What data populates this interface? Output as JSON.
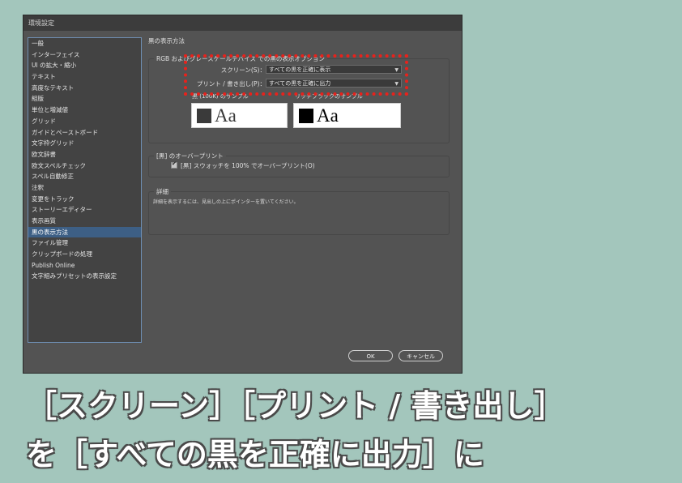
{
  "dialog": {
    "title": "環境設定",
    "ok_label": "OK",
    "cancel_label": "キャンセル"
  },
  "sidebar": {
    "items": [
      {
        "label": "一般",
        "selected": false
      },
      {
        "label": "インターフェイス",
        "selected": false
      },
      {
        "label": "UI の拡大・縮小",
        "selected": false
      },
      {
        "label": "テキスト",
        "selected": false
      },
      {
        "label": "高度なテキスト",
        "selected": false
      },
      {
        "label": "組版",
        "selected": false
      },
      {
        "label": "単位と増減値",
        "selected": false
      },
      {
        "label": "グリッド",
        "selected": false
      },
      {
        "label": "ガイドとペーストボード",
        "selected": false
      },
      {
        "label": "文字枠グリッド",
        "selected": false
      },
      {
        "label": "欧文辞書",
        "selected": false
      },
      {
        "label": "欧文スペルチェック",
        "selected": false
      },
      {
        "label": "スペル自動修正",
        "selected": false
      },
      {
        "label": "注釈",
        "selected": false
      },
      {
        "label": "変更をトラック",
        "selected": false
      },
      {
        "label": "ストーリーエディター",
        "selected": false
      },
      {
        "label": "表示画質",
        "selected": false
      },
      {
        "label": "黒の表示方法",
        "selected": true
      },
      {
        "label": "ファイル管理",
        "selected": false
      },
      {
        "label": "クリップボードの処理",
        "selected": false
      },
      {
        "label": "Publish Online",
        "selected": false
      },
      {
        "label": "文字組みプリセットの表示設定",
        "selected": false
      }
    ]
  },
  "main": {
    "section_title": "黒の表示方法",
    "rgb_group": {
      "legend": "RGB およびグレースケールデバイス での黒の表示オプション",
      "screen_label": "スクリーン(S)：",
      "screen_value": "すべての黒を正確に表示",
      "print_label": "プリント / 書き出し(P)：",
      "print_value": "すべての黒を正確に出力",
      "sample_100k_label": "黒 (100K) のサンプル",
      "sample_rich_label": "リッチブラックのサンプル",
      "sample_text": "Aa",
      "sample_100k_color": "#3a3a3a",
      "sample_rich_color": "#000000"
    },
    "overprint_group": {
      "legend": "[黒] のオーバープリント",
      "checkbox_label": "[黒] スウォッチを 100% でオーバープリント(O)",
      "checked": true
    },
    "detail_group": {
      "legend": "詳細",
      "text": "詳細を表示するには、見出しの上にポインターを置いてください。"
    }
  },
  "caption": {
    "line1": "［スクリーン］［プリント / 書き出し］",
    "line2": "を［すべての黒を正確に出力］に"
  },
  "colors": {
    "highlight_border": "#e8221c",
    "selected_item": "#3d5f85",
    "background": "#a3c6bc"
  }
}
